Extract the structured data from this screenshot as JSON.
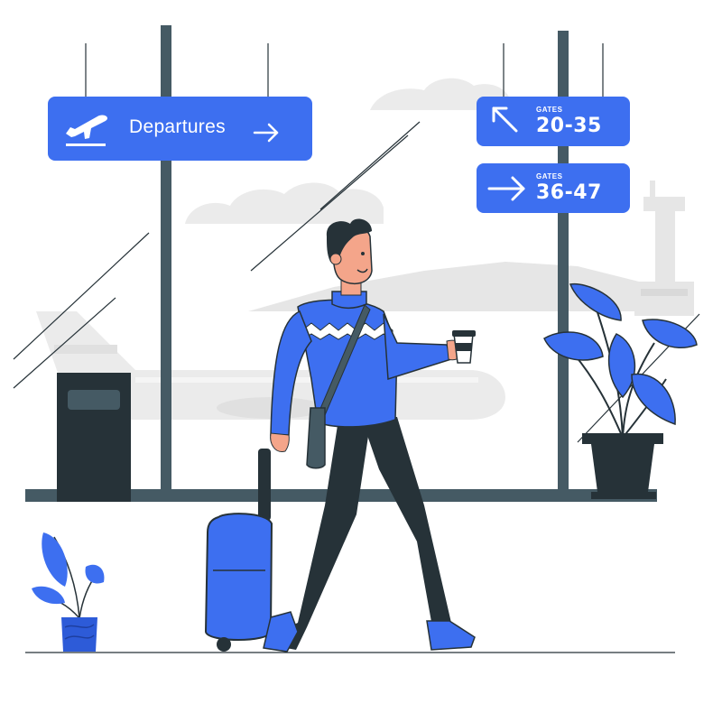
{
  "signs": {
    "departures": {
      "label": "Departures",
      "icon": "plane-takeoff-icon"
    },
    "gates_a": {
      "small": "GATES",
      "range": "20-35",
      "icon": "arrow-up-left-icon"
    },
    "gates_b": {
      "small": "GATES",
      "range": "36-47",
      "icon": "arrow-right-icon"
    }
  },
  "colors": {
    "accent": "#3d6ff0",
    "dark": "#263238",
    "frame": "#455a64",
    "light_gray": "#ebebeb",
    "skin": "#f4a58a"
  }
}
